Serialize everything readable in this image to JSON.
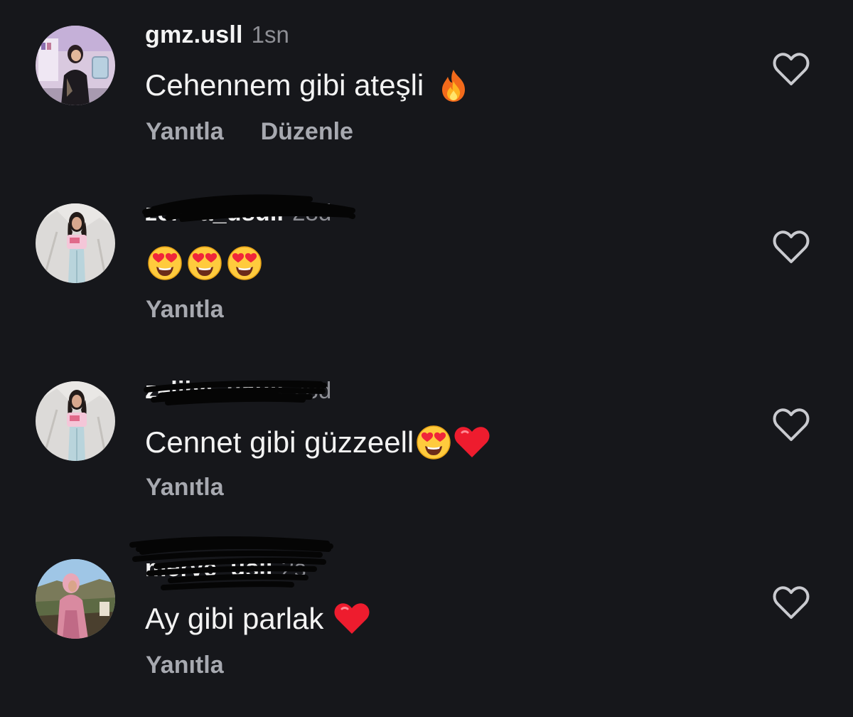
{
  "comments": [
    {
      "username": "gmz.usll",
      "time": "1sn",
      "text": "Cehennem gibi ateşli",
      "emojis": [
        "fire"
      ],
      "actions": [
        "Yanıtla",
        "Düzenle"
      ]
    },
    {
      "username": "zeliha_usull",
      "time": "28d",
      "text": "",
      "emojis": [
        "heart-eyes",
        "heart-eyes",
        "heart-eyes"
      ],
      "actions": [
        "Yanıtla"
      ]
    },
    {
      "username": "zeliha_usull",
      "time": "28d",
      "text": "Cennet gibi güzzeell",
      "emojis": [
        "heart-eyes",
        "red-heart"
      ],
      "actions": [
        "Yanıtla"
      ]
    },
    {
      "username": "merve_usll",
      "time": "2s",
      "text": "Ay gibi parlak",
      "emojis": [
        "red-heart"
      ],
      "actions": [
        "Yanıtla"
      ]
    }
  ],
  "colors": {
    "background": "#16171b",
    "text": "#f3f3f3",
    "muted": "#8e8f95",
    "action": "#a7a9b0",
    "like_icon": "#c9cacf"
  }
}
